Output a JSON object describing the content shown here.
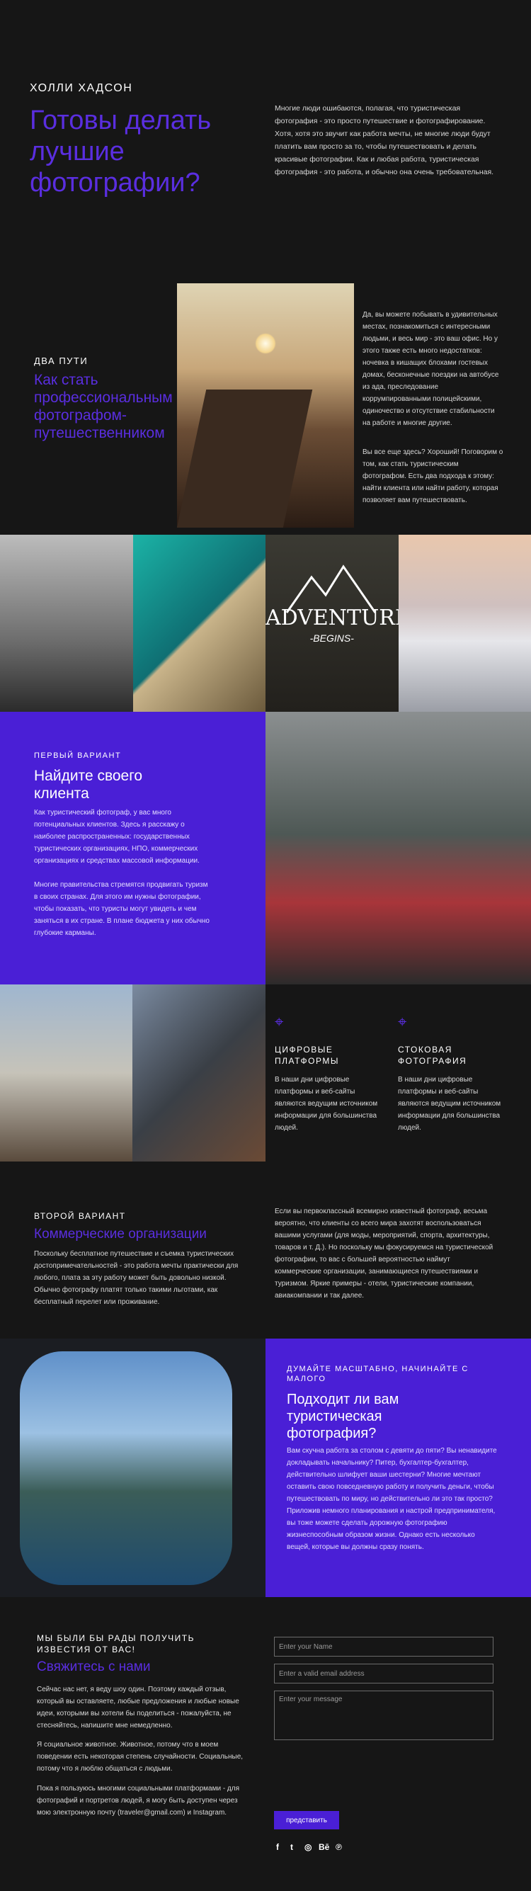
{
  "colors": {
    "accent": "#4a1fd6",
    "accent_text": "#5a2ee0",
    "background": "#161616"
  },
  "header": {
    "kicker": "ХОЛЛИ ХАДСОН",
    "title": "Готовы делать лучшие фотографии?",
    "text": "Многие люди ошибаются, полагая, что туристическая фотография - это просто путешествие и фотографирование. Хотя, хотя это звучит как работа мечты, не многие люди будут платить вам просто за то, чтобы путешествовать и делать красивые фотографии. Как и любая работа, туристическая фотография - это работа, и обычно она очень требовательная."
  },
  "two_paths": {
    "kicker": "ДВА ПУТИ",
    "title": "Как стать профессиональным фотографом-путешественником",
    "text1": "Да, вы можете побывать в удивительных местах, познакомиться с интересными людьми, и весь мир - это ваш офис. Но у этого также есть много недостатков: ночевка в кишащих блохами гостевых домах, бесконечные поездки на автобусе из ада, преследование коррумпированными полицейскими, одиночество и отсутствие стабильности на работе и многие другие.",
    "text2": "Вы все еще здесь? Хороший! Поговорим о том, как стать туристическим фотографом. Есть два подхода к этому: найти клиента или найти работу, которая позволяет вам путешествовать."
  },
  "strip": {
    "adventure_title": "ADVENTURE",
    "adventure_sub": "-BEGINS-"
  },
  "variant1": {
    "kicker": "ПЕРВЫЙ ВАРИАНТ",
    "title": "Найдите своего клиента",
    "text1": "Как туристический фотограф, у вас много потенциальных клиентов. Здесь я расскажу о наиболее распространенных: государственных туристических организациях, НПО, коммерческих организациях и средствах массовой информации.",
    "text2": "Многие правительства стремятся продвигать туризм в своих странах. Для этого им нужны фотографии, чтобы показать, что туристы могут увидеть и чем заняться в их стране. В плане бюджета у них обычно глубокие карманы."
  },
  "platforms": [
    {
      "icon": "map-pin-icon",
      "title": "ЦИФРОВЫЕ ПЛАТФОРМЫ",
      "text": "В наши дни цифровые платформы и веб-сайты являются ведущим источником информации для большинства людей."
    },
    {
      "icon": "map-pin-icon",
      "title": "СТОКОВАЯ ФОТОГРАФИЯ",
      "text": "В наши дни цифровые платформы и веб-сайты являются ведущим источником информации для большинства людей."
    }
  ],
  "variant2": {
    "kicker": "ВТОРОЙ ВАРИАНТ",
    "title": "Коммерческие организации",
    "text_left": "Поскольку бесплатное путешествие и съемка туристических достопримечательностей - это работа мечты практически для любого, плата за эту работу может быть довольно низкой. Обычно фотографу платят только такими льготами, как бесплатный перелет или проживание.",
    "text_right": "Если вы первоклассный всемирно известный фотограф, весьма вероятно, что клиенты со всего мира захотят воспользоваться вашими услугами (для моды, мероприятий, спорта, архитектуры, товаров и т. Д.). Но поскольку мы фокусируемся на туристической фотографии, то вас с большей вероятностью наймут коммерческие организации, занимающиеся путешествиями и туризмом. Яркие примеры - отели, туристические компании, авиакомпании и так далее."
  },
  "think_big": {
    "kicker": "ДУМАЙТЕ МАСШТАБНО, НАЧИНАЙТЕ С МАЛОГО",
    "title": "Подходит ли вам туристическая фотография?",
    "text": "Вам скучна работа за столом с девяти до пяти? Вы ненавидите докладывать начальнику? Питер, бухгалтер-бухгалтер, действительно шлифует ваши шестерни? Многие мечтают оставить свою повседневную работу и получить деньги, чтобы путешествовать по миру, но действительно ли это так просто? Приложив немного планирования и настрой предпринимателя, вы тоже можете сделать дорожную фотографию жизнеспособным образом жизни. Однако есть несколько вещей, которые вы должны сразу понять."
  },
  "contact": {
    "kicker": "МЫ БЫЛИ БЫ РАДЫ ПОЛУЧИТЬ ИЗВЕСТИЯ ОТ ВАС!",
    "title": "Свяжитесь с нами",
    "text1": "Сейчас нас нет, я веду шоу один. Поэтому каждый отзыв, который вы оставляете, любые предложения и любые новые идеи, которыми вы хотели бы поделиться - пожалуйста, не стесняйтесь, напишите мне немедленно.",
    "text2": "Я социальное животное. Животное, потому что в моем поведении есть некоторая степень случайности. Социальные, потому что я люблю общаться с людьми.",
    "text3": "Пока я пользуюсь многими социальными платформами - для фотографий и портретов людей, я могу быть доступен через мою электронную почту (traveler@gmail.com) и Instagram.",
    "name_placeholder": "Enter your Name",
    "email_placeholder": "Enter a valid email address",
    "message_placeholder": "Enter your message",
    "submit_label": "представить",
    "social": [
      "f",
      "t",
      "◎",
      "Bē",
      "℗"
    ]
  }
}
